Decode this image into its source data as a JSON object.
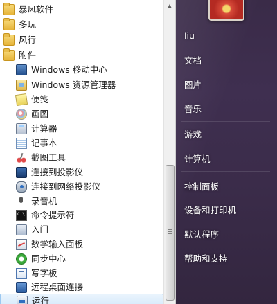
{
  "programs": [
    {
      "label": "暴风软件",
      "icon": "folder-icon"
    },
    {
      "label": "多玩",
      "icon": "folder-icon"
    },
    {
      "label": "风行",
      "icon": "folder-icon"
    },
    {
      "label": "附件",
      "icon": "folder-icon"
    },
    {
      "label": "Windows 移动中心",
      "icon": "mobility-center-icon"
    },
    {
      "label": "Windows 资源管理器",
      "icon": "explorer-icon"
    },
    {
      "label": "便笺",
      "icon": "sticky-notes-icon"
    },
    {
      "label": "画图",
      "icon": "paint-icon"
    },
    {
      "label": "计算器",
      "icon": "calculator-icon"
    },
    {
      "label": "记事本",
      "icon": "notepad-icon"
    },
    {
      "label": "截图工具",
      "icon": "snipping-tool-icon"
    },
    {
      "label": "连接到投影仪",
      "icon": "projector-icon"
    },
    {
      "label": "连接到网络投影仪",
      "icon": "network-projector-icon"
    },
    {
      "label": "录音机",
      "icon": "microphone-icon"
    },
    {
      "label": "命令提示符",
      "icon": "command-prompt-icon"
    },
    {
      "label": "入门",
      "icon": "getting-started-icon"
    },
    {
      "label": "数学输入面板",
      "icon": "math-input-icon"
    },
    {
      "label": "同步中心",
      "icon": "sync-center-icon"
    },
    {
      "label": "写字板",
      "icon": "wordpad-icon"
    },
    {
      "label": "远程桌面连接",
      "icon": "remote-desktop-icon"
    },
    {
      "label": "运行",
      "icon": "run-icon"
    }
  ],
  "right_menu": {
    "items": [
      {
        "label": "liu"
      },
      {
        "label": "文档"
      },
      {
        "label": "图片"
      },
      {
        "label": "音乐"
      },
      {
        "label": "游戏"
      },
      {
        "label": "计算机"
      },
      {
        "label": "控制面板"
      },
      {
        "label": "设备和打印机"
      },
      {
        "label": "默认程序"
      },
      {
        "label": "帮助和支持"
      }
    ]
  },
  "scrollbar": {
    "up_arrow": "▲",
    "grip": "≡"
  }
}
